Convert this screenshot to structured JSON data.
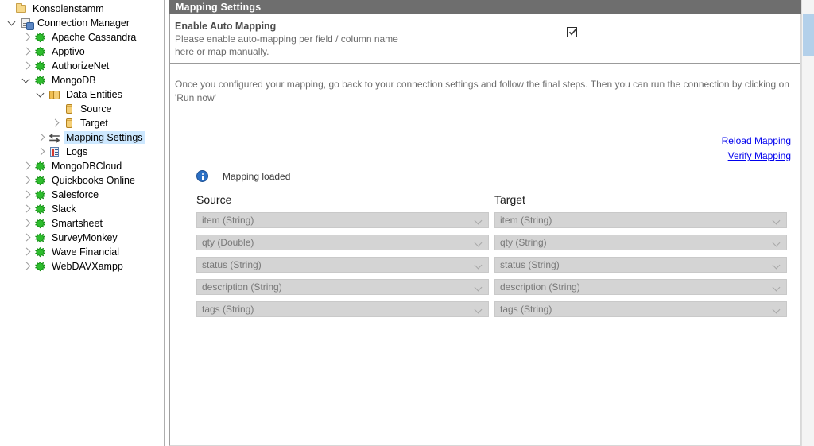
{
  "tree": {
    "items": [
      {
        "label": "Konsolenstamm",
        "icon": "folder-icon",
        "indent": 0,
        "twisty": "none",
        "selected": false
      },
      {
        "label": "Connection Manager",
        "icon": "connection-manager-icon",
        "indent": 1,
        "twisty": "expanded",
        "selected": false
      },
      {
        "label": "Apache Cassandra",
        "icon": "plug-icon",
        "indent": 2,
        "twisty": "collapsed",
        "selected": false
      },
      {
        "label": "Apptivo",
        "icon": "plug-icon",
        "indent": 2,
        "twisty": "collapsed",
        "selected": false
      },
      {
        "label": "AuthorizeNet",
        "icon": "plug-icon",
        "indent": 2,
        "twisty": "collapsed",
        "selected": false
      },
      {
        "label": "MongoDB",
        "icon": "plug-icon",
        "indent": 2,
        "twisty": "expanded",
        "selected": false
      },
      {
        "label": "Data Entities",
        "icon": "data-entities-icon",
        "indent": 3,
        "twisty": "expanded",
        "selected": false
      },
      {
        "label": "Source",
        "icon": "cylinder-icon",
        "indent": 4,
        "twisty": "none",
        "selected": false
      },
      {
        "label": "Target",
        "icon": "cylinder-icon",
        "indent": 4,
        "twisty": "collapsed",
        "selected": false
      },
      {
        "label": "Mapping Settings",
        "icon": "mapping-arrows-icon",
        "indent": 3,
        "twisty": "collapsed",
        "selected": true
      },
      {
        "label": "Logs",
        "icon": "logs-icon",
        "indent": 3,
        "twisty": "collapsed",
        "selected": false
      },
      {
        "label": "MongoDBCloud",
        "icon": "plug-icon",
        "indent": 2,
        "twisty": "collapsed",
        "selected": false
      },
      {
        "label": "Quickbooks Online",
        "icon": "plug-icon",
        "indent": 2,
        "twisty": "collapsed",
        "selected": false
      },
      {
        "label": "Salesforce",
        "icon": "plug-icon",
        "indent": 2,
        "twisty": "collapsed",
        "selected": false
      },
      {
        "label": "Slack",
        "icon": "plug-icon",
        "indent": 2,
        "twisty": "collapsed",
        "selected": false
      },
      {
        "label": "Smartsheet",
        "icon": "plug-icon",
        "indent": 2,
        "twisty": "collapsed",
        "selected": false
      },
      {
        "label": "SurveyMonkey",
        "icon": "plug-icon",
        "indent": 2,
        "twisty": "collapsed",
        "selected": false
      },
      {
        "label": "Wave Financial",
        "icon": "plug-icon",
        "indent": 2,
        "twisty": "collapsed",
        "selected": false
      },
      {
        "label": "WebDAVXampp",
        "icon": "plug-icon",
        "indent": 2,
        "twisty": "collapsed",
        "selected": false
      }
    ]
  },
  "panel": {
    "title": "Mapping Settings",
    "auto_mapping": {
      "title": "Enable Auto Mapping",
      "description_line1": "Please enable auto-mapping per field / column name",
      "description_line2": "here or map manually.",
      "checked": true
    },
    "instructions": "Once you configured your mapping, go back to your connection settings and follow the final steps. Then you can run the connection by clicking on 'Run now'",
    "links": [
      {
        "label": "Reload Mapping"
      },
      {
        "label": "Verify Mapping"
      }
    ],
    "status": {
      "icon": "info-icon",
      "text": "Mapping loaded"
    },
    "columns": {
      "source_header": "Source",
      "target_header": "Target"
    },
    "mappings": [
      {
        "source": "item (String)",
        "target": "item (String)"
      },
      {
        "source": "qty (Double)",
        "target": "qty (String)"
      },
      {
        "source": "status (String)",
        "target": "status (String)"
      },
      {
        "source": "description (String)",
        "target": "description (String)"
      },
      {
        "source": "tags (String)",
        "target": "tags (String)"
      }
    ]
  },
  "colors": {
    "title_bar": "#6e6e6e",
    "selection": "#cde8ff",
    "link": "#0000ee",
    "combo_bg": "#d4d4d4",
    "info": "#2a6fc4",
    "scroll_thumb": "#b3d0ea"
  }
}
